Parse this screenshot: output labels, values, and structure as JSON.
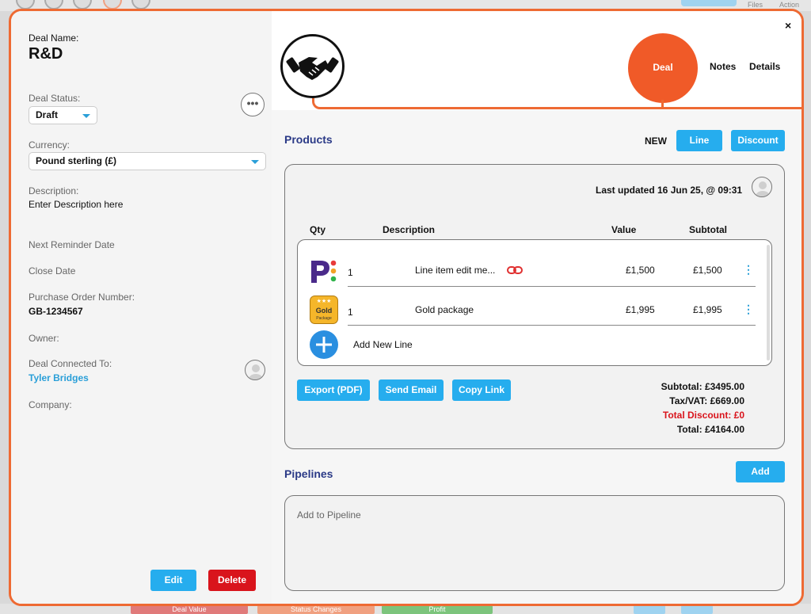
{
  "background": {
    "top_labels": [
      "Files",
      "Action"
    ],
    "bottom_labels": [
      "Deal Value",
      "Status Changes",
      "Profit"
    ]
  },
  "left_panel": {
    "deal_name_label": "Deal Name:",
    "deal_name": "R&D",
    "deal_status_label": "Deal Status:",
    "deal_status": "Draft",
    "currency_label": "Currency:",
    "currency": "Pound sterling (£)",
    "description_label": "Description:",
    "description": "Enter Description here",
    "next_reminder_label": "Next Reminder Date",
    "close_date_label": "Close Date",
    "po_number_label": "Purchase Order Number:",
    "po_number": "GB-1234567",
    "owner_label": "Owner:",
    "connected_label": "Deal Connected To:",
    "connected_to": "Tyler Bridges",
    "company_label": "Company:",
    "more_label": "•••",
    "edit_label": "Edit",
    "delete_label": "Delete"
  },
  "header": {
    "tabs": [
      {
        "label": "Deal",
        "active": true
      },
      {
        "label": "Notes",
        "active": false
      },
      {
        "label": "Details",
        "active": false
      }
    ],
    "close_label": "×",
    "logo_icon": "handshake-icon"
  },
  "products": {
    "title": "Products",
    "new_label": "NEW",
    "line_button": "Line",
    "discount_button": "Discount",
    "last_updated": "Last updated 16 Jun 25, @ 09:31",
    "columns": [
      "Qty",
      "Description",
      "Value",
      "Subtotal"
    ],
    "lines": [
      {
        "qty": "1",
        "description": "Line item edit me...",
        "value": "£1,500",
        "subtotal": "£1,500",
        "linked": true
      },
      {
        "qty": "1",
        "description": "Gold package",
        "value": "£1,995",
        "subtotal": "£1,995",
        "linked": false
      }
    ],
    "add_line_label": "Add New Line",
    "export_button": "Export (PDF)",
    "email_button": "Send Email",
    "copy_button": "Copy Link",
    "subtotal": "Subtotal: £3495.00",
    "tax": "Tax/VAT: £669.00",
    "discount": "Total Discount: £0",
    "total": "Total: £4164.00"
  },
  "pipelines": {
    "title": "Pipelines",
    "add_button": "Add",
    "placeholder": "Add to Pipeline"
  },
  "colors": {
    "accent": "#26adee",
    "orange": "#ee6a33",
    "danger": "#d9141c",
    "section_title": "#2b3a87"
  }
}
